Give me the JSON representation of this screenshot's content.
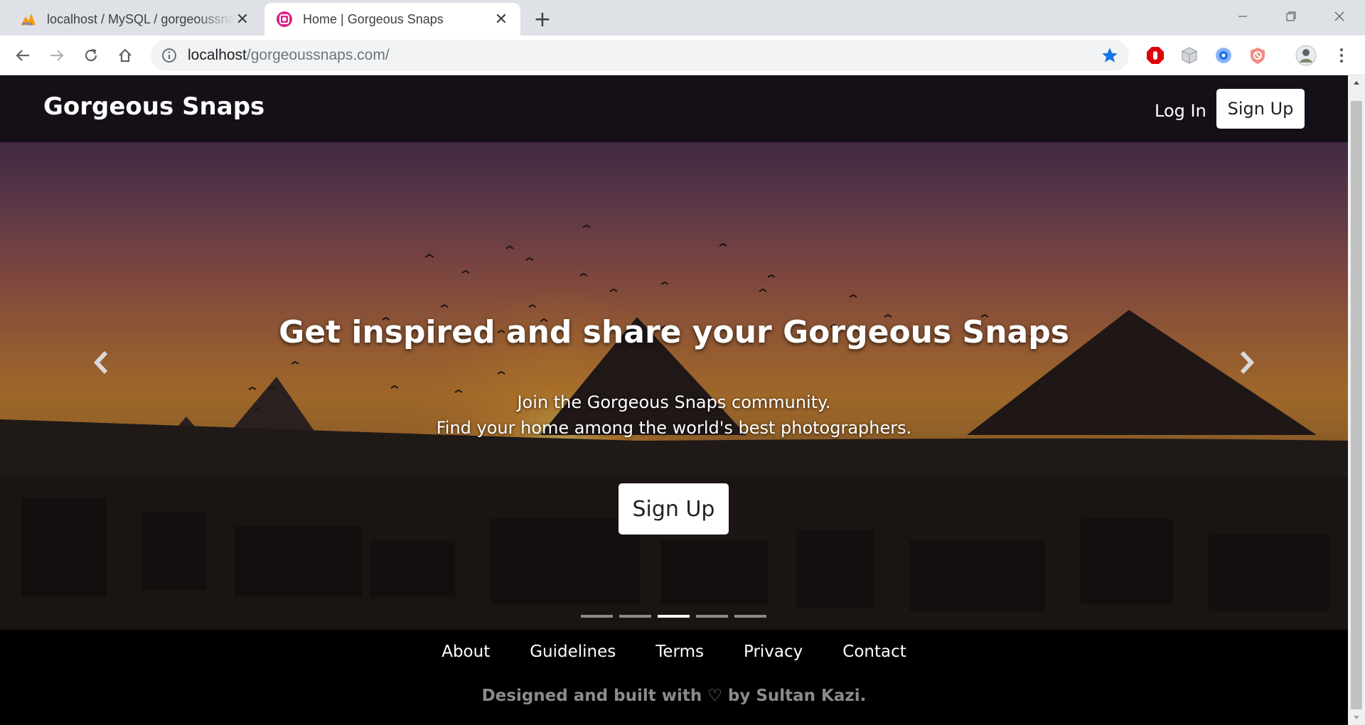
{
  "browser": {
    "tabs": [
      {
        "title": "localhost / MySQL / gorgeoussnaps",
        "favicon": "phpmyadmin-icon",
        "active": false
      },
      {
        "title": "Home | Gorgeous Snaps",
        "favicon": "site-icon",
        "active": true
      }
    ],
    "url_host": "localhost",
    "url_path": "/gorgeoussnaps.com/",
    "accent_color": "#1a73e8"
  },
  "nav": {
    "brand": "Gorgeous Snaps",
    "login": "Log In",
    "signup": "Sign Up"
  },
  "hero": {
    "title": "Get inspired and share your Gorgeous Snaps",
    "subtitle_line1": "Join the Gorgeous Snaps community.",
    "subtitle_line2": "Find your home among the world's best photographers.",
    "cta": "Sign Up",
    "slides_total": 5,
    "active_slide": 3
  },
  "footer": {
    "links": [
      "About",
      "Guidelines",
      "Terms",
      "Privacy",
      "Contact"
    ],
    "credit": "Designed and built with ♡ by Sultan Kazi."
  }
}
